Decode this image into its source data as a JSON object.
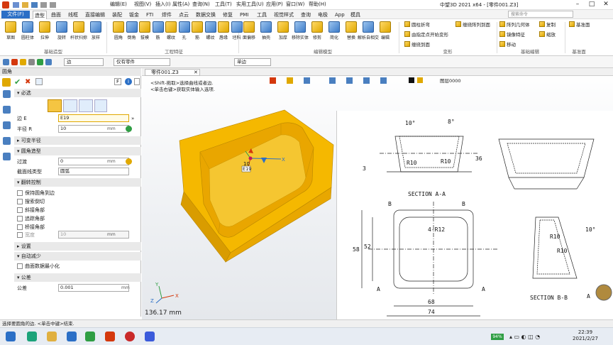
{
  "window": {
    "title": "中望3D 2021 x64 - [零件001.Z3]",
    "min": "–",
    "max": "□",
    "close": "✕"
  },
  "menu": {
    "file": "文件(F)",
    "items": [
      "编辑(E)",
      "视图(V)",
      "插入(I)",
      "属性(A)",
      "查询(N)",
      "工具(T)",
      "实用工具(U)",
      "应用(P)",
      "窗口(W)",
      "帮助(H)"
    ],
    "search_placeholder": "搜索命令"
  },
  "ribbon_tabs": [
    "造型",
    "曲面",
    "线框",
    "直接编辑",
    "装配",
    "钣金",
    "FTI",
    "焊件",
    "点云",
    "数据交换",
    "修复",
    "PMI",
    "工具",
    "视觉样式",
    "查询",
    "电极",
    "App",
    "模具"
  ],
  "ribbon": {
    "base_buttons": [
      "草图",
      "圆柱体",
      "拉伸",
      "旋转",
      "杆状扫掠",
      "放样"
    ],
    "eng_buttons": [
      "圆角",
      "倒角",
      "拔模",
      "筋",
      "螺纹",
      "孔",
      "筋",
      "螺纹",
      "唇缘",
      "坯料"
    ],
    "edit_buttons": [
      "面偏移",
      "抽壳",
      "加厚",
      "移除实体",
      "修剪",
      "简化",
      "替换",
      "解析自相交",
      "编辑"
    ],
    "groups": [
      "基础造型",
      "工程特征",
      "编辑模型",
      "变形",
      "基础编辑",
      "基准面"
    ],
    "deform_items": [
      "圆柱折弯",
      "由指定点开始变形",
      "缠绕到面",
      "缠绕阵列到面"
    ],
    "basic_edit_items": [
      "阵列几何体",
      "镜像特征",
      "移动",
      "复制",
      "缩放"
    ],
    "datum_item": "基准面"
  },
  "quickbar": {
    "filter": "边",
    "part_filter": "仅有零件",
    "mode": "单边"
  },
  "panel": {
    "title": "圆角",
    "ok": "✔",
    "cancel": "✖",
    "f_label": "F",
    "info": "i",
    "sections": {
      "required": "必选",
      "variable_radius": "可变半径",
      "fillet_shape": "圆角造型",
      "overflow": "翻转控制",
      "settings": "设置",
      "auto_reduce": "自动减少",
      "tolerance": "公差"
    },
    "edge_label": "边 E",
    "edge_value": "E19",
    "radius_label": "半径 R",
    "radius_value": "10",
    "radius_unit": "mm",
    "transition_label": "过渡",
    "transition_value": "0",
    "transition_unit": "mm",
    "section_label": "截面线类型",
    "section_value": "圆弧",
    "overflow_options": [
      "保持圆角到边",
      "搜索倒切",
      "斜接角部",
      "追踪角部",
      "桥接角部"
    ],
    "width_label": "宽度",
    "width_value": "10",
    "width_unit": "mm",
    "auto_reduce_option": "曲面数据最小化",
    "tolerance_label": "公差",
    "tolerance_value": "0.001",
    "tolerance_unit": "mm"
  },
  "viewport": {
    "doc_tab": "零件001.Z3",
    "hint1": "<Shift-拖取>选择曲线或者边.",
    "hint2": "<单击右键>获取实体输入选项.",
    "view_name": "图层0000",
    "edge_tag": "E19",
    "value_tag": "10",
    "axis_x": "X",
    "axis_y": "Y",
    "axis_z": "Z",
    "measure": "136.17 mm"
  },
  "drawing": {
    "section_aa": "SECTION A-A",
    "section_bb": "SECTION B-B",
    "dims": [
      "10°",
      "8°",
      "R10",
      "R10",
      "36",
      "3",
      "4-R12",
      "58",
      "52",
      "68",
      "74",
      "R10",
      "R10",
      "10°"
    ],
    "labels": [
      "B",
      "B",
      "A",
      "A",
      "A"
    ]
  },
  "status": {
    "text": "选择要圆角的边. <单击中键>结束.",
    "battery": "94%"
  },
  "taskbar": {
    "time": "22:39",
    "date": "2021/2/27"
  }
}
